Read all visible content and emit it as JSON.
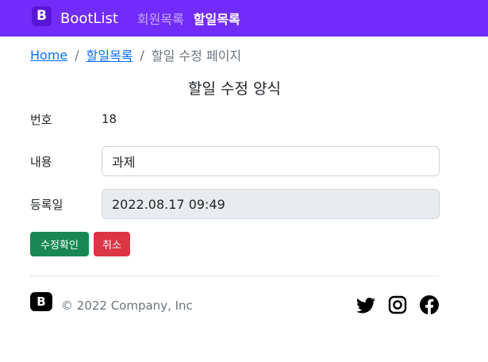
{
  "navbar": {
    "brand_logo": "B",
    "brand_name": "BootList",
    "links": [
      {
        "label": "회원목록",
        "active": false
      },
      {
        "label": "할일목록",
        "active": true
      }
    ]
  },
  "breadcrumb": {
    "items": [
      "Home",
      "할일목록"
    ],
    "current": "할일 수정 페이지",
    "separator": "/"
  },
  "form": {
    "title": "할일 수정 양식",
    "number_label": "번호",
    "number_value": "18",
    "content_label": "내용",
    "content_value": "과제",
    "date_label": "등록일",
    "date_value": "2022.08.17 09:49",
    "submit_label": "수정확인",
    "cancel_label": "취소"
  },
  "footer": {
    "logo": "B",
    "copyright": "© 2022 Company, Inc",
    "socials": [
      "twitter-icon",
      "instagram-icon",
      "facebook-icon"
    ]
  },
  "colors": {
    "navbar": "#712cf9",
    "link": "#0d6efd",
    "success": "#198754",
    "danger": "#dc3545"
  }
}
